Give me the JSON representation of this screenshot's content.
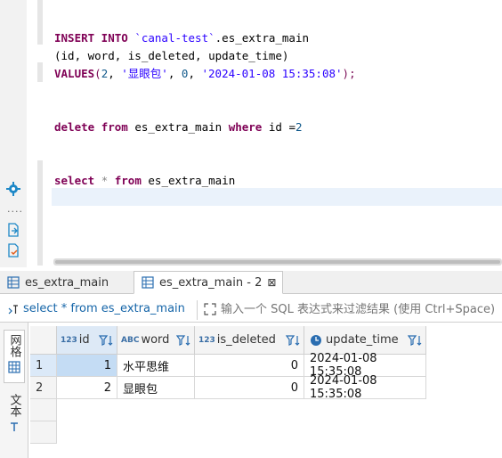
{
  "editor": {
    "line1": {
      "kw1": "INSERT INTO",
      "str1": "`canal-test`",
      "rest": ".es_extra_main"
    },
    "line2": "(id, word, is_deleted, update_time)",
    "line3": {
      "kw": "VALUES",
      "open": "(",
      "num1": "2",
      "c1": ", ",
      "str1": "'显眼包'",
      "c2": ", ",
      "num2": "0",
      "c3": ", ",
      "str2": "'2024-01-08 15:35:08'",
      "close": ");"
    },
    "line4": {
      "kw1": "delete",
      "kw2": "from",
      "table": "es_extra_main",
      "kw3": "where",
      "cond": "id =",
      "num": "2"
    },
    "line5": {
      "kw1": "select",
      "star": "*",
      "kw2": "from",
      "table": "es_extra_main"
    }
  },
  "tabs": [
    {
      "label": "es_extra_main",
      "icon": "table-icon"
    },
    {
      "label": "es_extra_main - 2",
      "icon": "table-icon",
      "close": "⊠"
    }
  ],
  "filter": {
    "query_label": "select * from es_extra_main",
    "placeholder": "输入一个 SQL 表达式来过滤结果 (使用 Ctrl+Space)"
  },
  "sidetabs": {
    "grid": "网格",
    "text": "文本"
  },
  "grid": {
    "columns": [
      {
        "type": "123",
        "name": "id"
      },
      {
        "type": "ABC",
        "name": "word"
      },
      {
        "type": "123",
        "name": "is_deleted"
      },
      {
        "type": "clock",
        "name": "update_time"
      }
    ],
    "rows": [
      {
        "num": "1",
        "id": "1",
        "word": "水平思维",
        "is_deleted": "0",
        "update_time": "2024-01-08 15:35:08"
      },
      {
        "num": "2",
        "id": "2",
        "word": "显眼包",
        "is_deleted": "0",
        "update_time": "2024-01-08 15:35:08"
      }
    ]
  },
  "colors": {
    "keyword": "#7f0055",
    "string": "#2a00ff",
    "selection": "#c4dcf4",
    "query_link": "#1565a8"
  }
}
